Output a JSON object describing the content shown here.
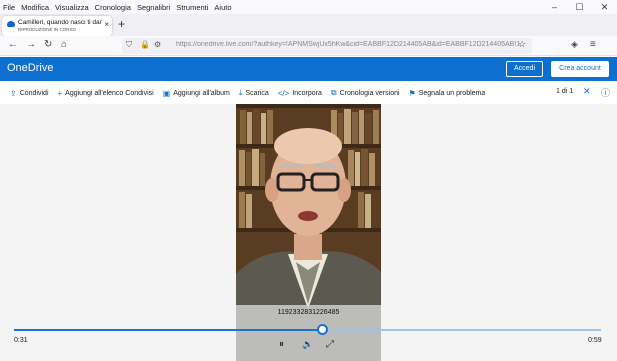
{
  "menubar": {
    "items": [
      "File",
      "Modifica",
      "Visualizza",
      "Cronologia",
      "Segnalibri",
      "Strumenti",
      "Aiuto"
    ]
  },
  "window_controls": {
    "minimize": "–",
    "maximize": "☐",
    "close": "✕"
  },
  "tab": {
    "title": "Camilleri, quando nasci ti dann",
    "subtitle": "RIPRODUZIONE IN CORSO",
    "close": "×"
  },
  "new_tab": "+",
  "nav": {
    "back": "←",
    "forward": "→",
    "reload": "↻",
    "home": "⌂",
    "url": "https://onedrive.live.com/?authkey=!APNMSwjUx5hKw&cid=EABBF12D214405AB&id=EABBF12D214405AB!1",
    "star": "☆"
  },
  "onedrive": {
    "brand": "OneDrive",
    "signin": "Accedi",
    "create_account": "Crea account"
  },
  "commands": [
    {
      "icon": "share-icon",
      "glyph": "⇪",
      "label": "Condividi"
    },
    {
      "icon": "plus-icon",
      "glyph": "+",
      "label": "Aggiungi all'elenco Condivisi"
    },
    {
      "icon": "album-icon",
      "glyph": "▣",
      "label": "Aggiungi all'album"
    },
    {
      "icon": "download-icon",
      "glyph": "⤓",
      "label": "Scarica"
    },
    {
      "icon": "embed-icon",
      "glyph": "</>",
      "label": "Incorpora"
    },
    {
      "icon": "history-icon",
      "glyph": "⧉",
      "label": "Cronologia versioni"
    },
    {
      "icon": "flag-icon",
      "glyph": "⚑",
      "label": "Segnala un problema"
    }
  ],
  "pager": {
    "text": "1 di 1",
    "close": "✕",
    "info": "ⓘ"
  },
  "player": {
    "caption": "1192332831226485",
    "elapsed": "0:31",
    "duration": "0:59",
    "progress": 0.525,
    "pause": "⏸",
    "volume": "🔊",
    "fullscreen": "⤢"
  },
  "colors": {
    "accent": "#0d6fd0",
    "seek": "#1a73d1"
  }
}
